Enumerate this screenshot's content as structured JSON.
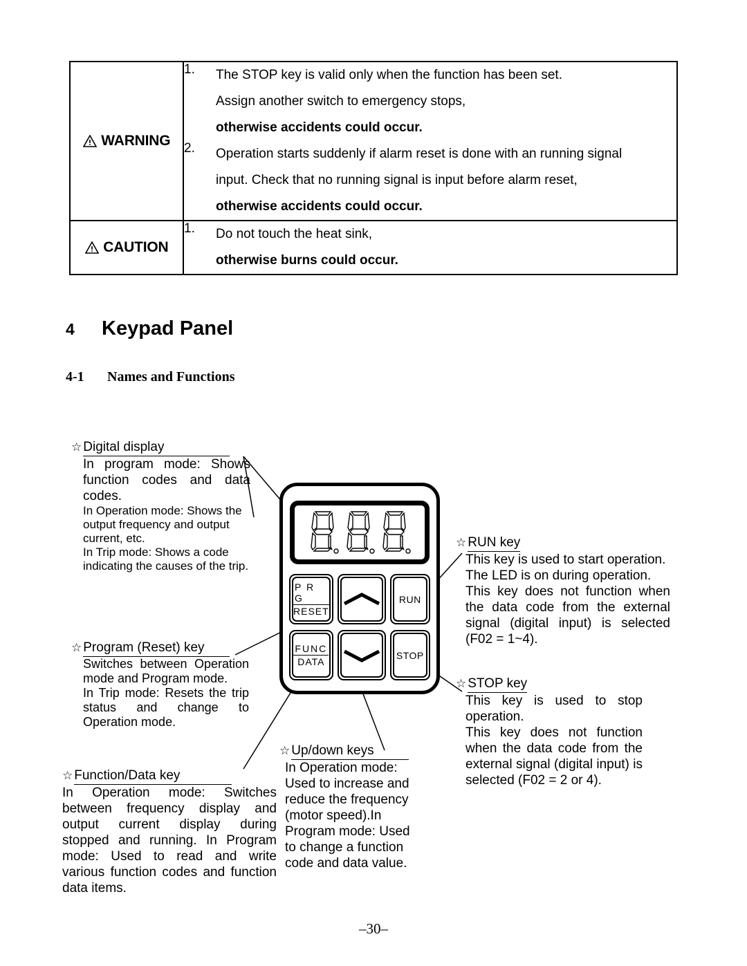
{
  "notice_table": {
    "rows": [
      {
        "label": "WARNING",
        "icon": "warning-triangle-icon",
        "items": [
          {
            "number": "1.",
            "lines": [
              {
                "text": "The STOP key is valid only when the function has been set.",
                "bold": false
              },
              {
                "text": "Assign another switch to emergency stops,",
                "bold": false
              },
              {
                "text": "otherwise accidents could occur.",
                "bold": true
              }
            ]
          },
          {
            "number": "2.",
            "lines": [
              {
                "text": "Operation starts suddenly if alarm reset is done with an running signal",
                "bold": false
              },
              {
                "text": "input.  Check that no running signal is input before alarm reset,",
                "bold": false
              },
              {
                "text": "otherwise accidents could occur.",
                "bold": true
              }
            ]
          }
        ]
      },
      {
        "label": "CAUTION",
        "icon": "warning-triangle-icon",
        "items": [
          {
            "number": "1.",
            "lines": [
              {
                "text": "Do not touch the heat sink,",
                "bold": false
              },
              {
                "text": "otherwise burns could occur.",
                "bold": true
              }
            ]
          }
        ]
      }
    ]
  },
  "headings": {
    "chapter_number": "4",
    "chapter_title": "Keypad Panel",
    "section_number": "4-1",
    "section_title": "Names and Functions"
  },
  "annotations": {
    "bullet": "☆",
    "digital_display": {
      "title": "Digital display",
      "para1": "In program mode: Shows function codes and data codes.",
      "para2": "In Operation mode: Shows the output frequency and output current, etc.",
      "para3": "In Trip mode:  Shows a code indicating the causes of the trip."
    },
    "program_reset_key": {
      "title": "Program (Reset) key",
      "para1": "Switches between Operation mode and Program mode.",
      "para2": "In Trip mode:  Resets the trip status and change to Operation mode."
    },
    "function_data_key": {
      "title": "Function/Data key",
      "para1": "In Operation mode:   Switches between frequency display and output current display during stopped and running. In Program mode:  Used to read and write various function codes and function data items."
    },
    "up_down_keys": {
      "title": "Up/down keys",
      "para1": "In Operation mode: Used to increase and reduce the frequency (motor speed).In Program mode:  Used to change a function code and data value."
    },
    "run_key": {
      "title": "RUN key",
      "para1": "This key is used to start operation.",
      "para2": "The LED is on during operation.",
      "para3": "This key does not function when the data code from the external signal (digital input) is selected (F02 = 1~4)."
    },
    "stop_key": {
      "title": "STOP key",
      "para1": "This key is used to stop operation.",
      "para2": "This key does not function when the data code from the external signal (digital input) is selected (F02 = 2 or 4)."
    }
  },
  "keypad": {
    "display_digits": [
      "8",
      "8",
      "8"
    ],
    "decimal_points": 3,
    "keys": [
      {
        "name": "prg-reset-key",
        "top_label": "P R G",
        "bottom_label": "RESET",
        "icon": ""
      },
      {
        "name": "up-key",
        "top_label": "",
        "bottom_label": "",
        "icon": "chevron-up-icon"
      },
      {
        "name": "run-key",
        "top_label": "",
        "bottom_label": "RUN",
        "icon": ""
      },
      {
        "name": "func-data-key",
        "top_label": "FUNC",
        "bottom_label": "DATA",
        "icon": ""
      },
      {
        "name": "down-key",
        "top_label": "",
        "bottom_label": "",
        "icon": "chevron-down-icon"
      },
      {
        "name": "stop-key",
        "top_label": "",
        "bottom_label": "STOP",
        "icon": ""
      }
    ]
  },
  "footer": {
    "page": "–30–"
  },
  "colors": {
    "ink": "#000000",
    "page": "#ffffff"
  }
}
